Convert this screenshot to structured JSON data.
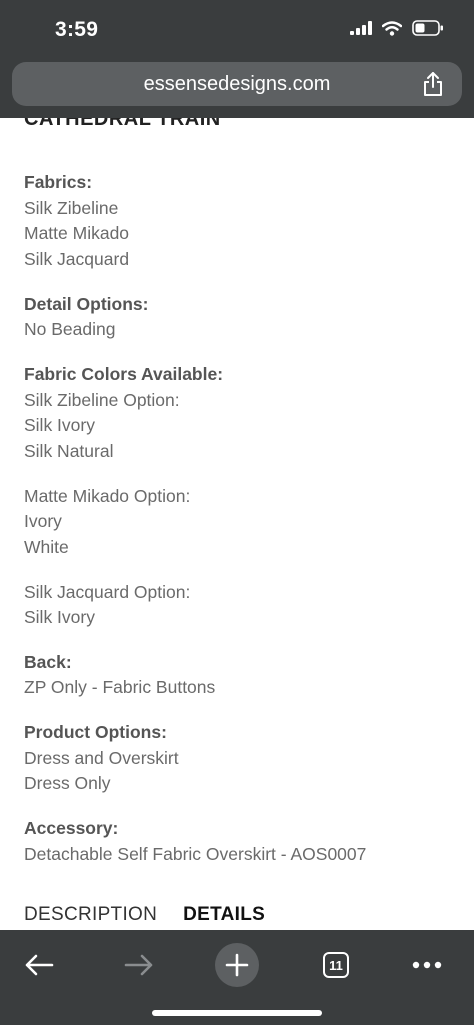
{
  "status_bar": {
    "time": "3:59"
  },
  "browser": {
    "url": "essensedesigns.com",
    "tab_count": "11"
  },
  "page": {
    "cut_heading": "CATHEDRAL TRAIN",
    "sections": [
      {
        "title": "Fabrics:",
        "lines": [
          "Silk Zibeline",
          "Matte Mikado",
          "Silk Jacquard"
        ]
      },
      {
        "title": "Detail Options:",
        "lines": [
          "No Beading"
        ]
      },
      {
        "title": "Fabric Colors Available:",
        "lines": [
          "Silk Zibeline Option:",
          "Silk Ivory",
          "Silk Natural"
        ]
      },
      {
        "title": "",
        "lines": [
          "Matte Mikado Option:",
          "Ivory",
          "White"
        ]
      },
      {
        "title": "",
        "lines": [
          "Silk Jacquard Option:",
          "Silk Ivory"
        ]
      },
      {
        "title": "Back:",
        "lines": [
          "ZP Only - Fabric Buttons"
        ]
      },
      {
        "title": "Product Options:",
        "lines": [
          "Dress and Overskirt",
          "Dress Only"
        ]
      },
      {
        "title": "Accessory:",
        "lines": [
          "Detachable Self Fabric Overskirt - AOS0007"
        ]
      }
    ],
    "tabs": {
      "description": "DESCRIPTION",
      "details": "DETAILS"
    }
  },
  "icons": {
    "signal": "cellular-signal-icon",
    "wifi": "wifi-icon",
    "battery": "battery-icon",
    "share": "share-icon",
    "back": "back-arrow-icon",
    "forward": "forward-arrow-icon",
    "new_tab": "plus-icon",
    "tabs": "tabs-icon",
    "more": "more-icon"
  },
  "colors": {
    "chrome_bg": "#3a3d3e",
    "url_bar_bg": "#5d6062",
    "text_gray": "#6a6a6a",
    "title_gray": "#555555"
  }
}
